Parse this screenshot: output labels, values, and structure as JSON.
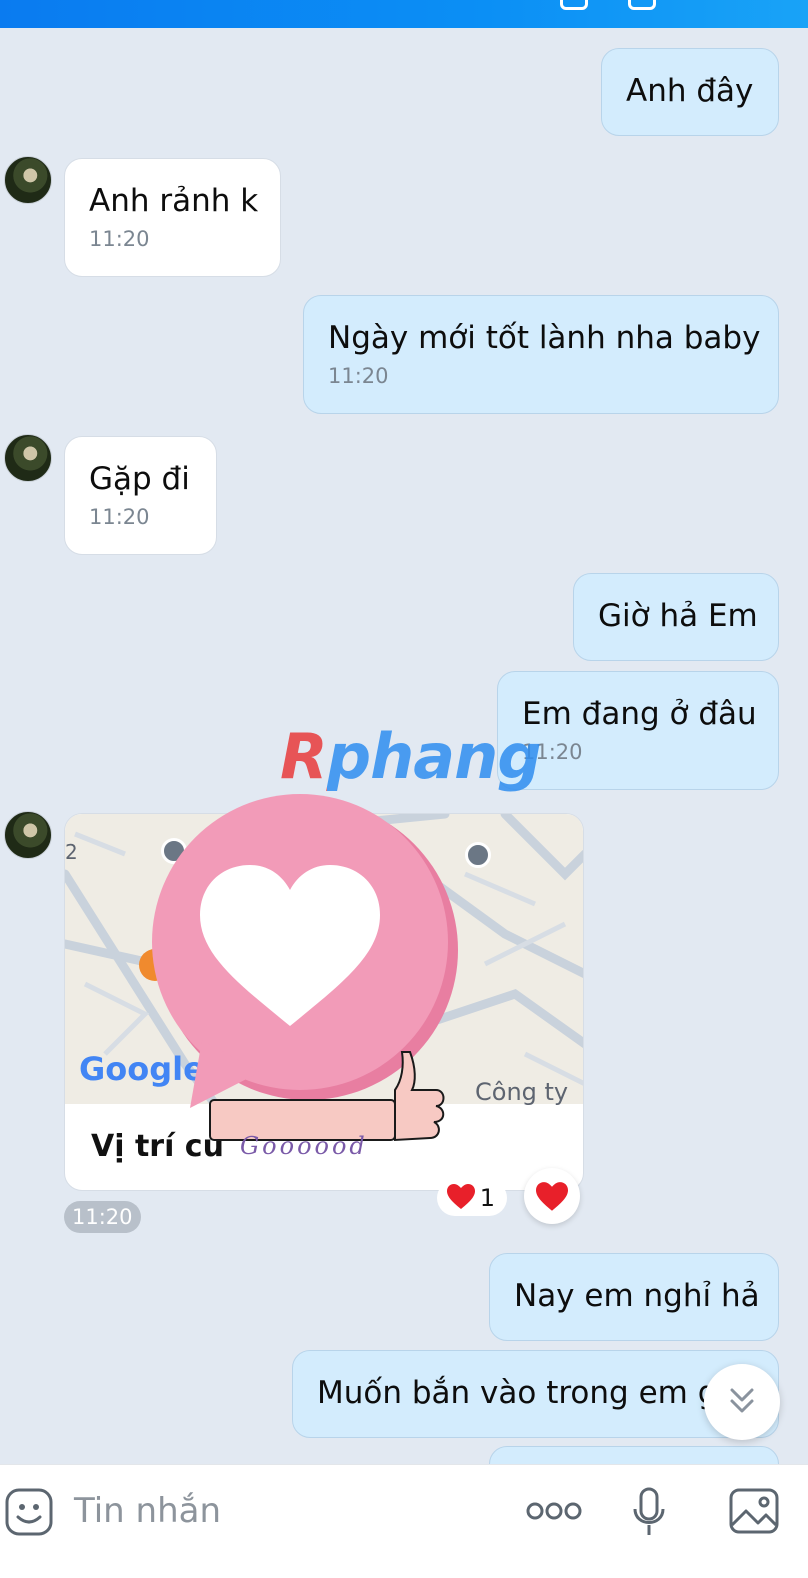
{
  "messages": [
    {
      "side": "out",
      "text": "Anh đây",
      "time": ""
    },
    {
      "side": "in",
      "text": "Anh rảnh k",
      "time": "11:20"
    },
    {
      "side": "out",
      "text": "Ngày mới tốt lành nha baby",
      "time": "11:20"
    },
    {
      "side": "in",
      "text": "Gặp đi",
      "time": "11:20"
    },
    {
      "side": "out",
      "text": "Giờ hả Em",
      "time": ""
    },
    {
      "side": "out",
      "text": "Em đang ở đâu",
      "time": "11:20"
    },
    {
      "side": "out",
      "text": "Nay em nghỉ hả",
      "time": ""
    },
    {
      "side": "out",
      "text": "Muốn bắn vào trong em g",
      "time": ""
    }
  ],
  "location_card": {
    "caption": "Vị trí cu",
    "map_label_company": "Công ty",
    "map_brand": "Google",
    "map_corner_label": "2",
    "time": "11:20",
    "reaction_count": "1"
  },
  "watermark": "Rphang",
  "sticker_text": "Goooood",
  "input": {
    "placeholder": "Tin nhắn"
  },
  "colors": {
    "header": "#0b8ff5",
    "background": "#e2e9f2",
    "outgoing_bubble": "#d3ecfd",
    "incoming_bubble": "#ffffff",
    "heart": "#e8202a",
    "sticker_pink": "#f29bb8"
  },
  "icons": [
    "sticker-icon",
    "more-icon",
    "microphone-icon",
    "image-icon",
    "scroll-down-icon",
    "heart-icon",
    "bus-stop-icon"
  ]
}
